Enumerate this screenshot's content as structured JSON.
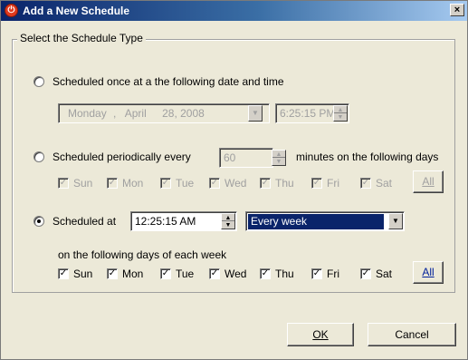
{
  "window": {
    "title": "Add a New Schedule",
    "close_glyph": "×"
  },
  "group": {
    "legend": "Select the Schedule Type"
  },
  "once": {
    "label": "Scheduled once at a the following date and time",
    "date_weekday": "Monday",
    "date_sep1": ",",
    "date_month": "April",
    "date_day_year": "28, 2008",
    "time": "6:25:15 PM"
  },
  "periodic": {
    "label": "Scheduled periodically every",
    "minutes": "60",
    "suffix": "minutes on the following days",
    "days": [
      "Sun",
      "Mon",
      "Tue",
      "Wed",
      "Thu",
      "Fri",
      "Sat"
    ],
    "all_label": "All"
  },
  "scheduled_at": {
    "label": "Scheduled at",
    "time": "12:25:15 AM",
    "frequency": "Every week",
    "days_caption": "on the following days of each week",
    "days": [
      "Sun",
      "Mon",
      "Tue",
      "Wed",
      "Thu",
      "Fri",
      "Sat"
    ],
    "all_label": "All"
  },
  "buttons": {
    "ok_label": "OK",
    "cancel_label": "Cancel"
  },
  "colors": {
    "titlebar": "#0a246a",
    "selection": "#0a246a",
    "face": "#ece9d8"
  }
}
